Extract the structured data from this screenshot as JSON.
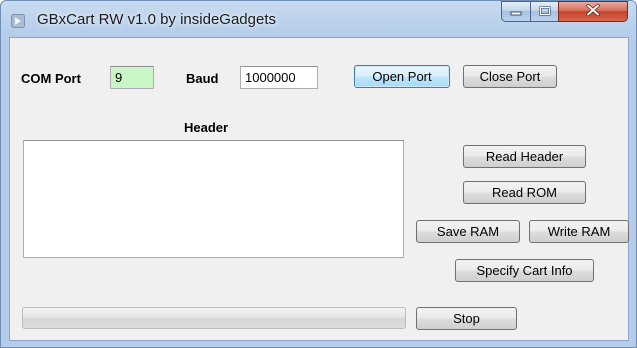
{
  "window": {
    "title": "GBxCart RW v1.0 by insideGadgets"
  },
  "caption_buttons": {
    "minimize_icon": "minimize-icon",
    "maximize_icon": "maximize-icon",
    "close_icon": "close-icon"
  },
  "connection": {
    "com_port_label": "COM Port",
    "com_port_value": "9",
    "com_port_bg": "#c8f7c5",
    "baud_label": "Baud",
    "baud_value": "1000000",
    "open_port_label": "Open Port",
    "close_port_label": "Close Port"
  },
  "header_section": {
    "label": "Header",
    "content": ""
  },
  "actions": {
    "read_header": "Read Header",
    "read_rom": "Read ROM",
    "save_ram": "Save RAM",
    "write_ram": "Write RAM",
    "specify_cart_info": "Specify Cart Info",
    "stop": "Stop"
  },
  "progress": {
    "value_percent": 0
  },
  "colors": {
    "titlebar_accent": "#bcd2ec",
    "focused_button": "#3c7fb1",
    "close_button": "#c2442a"
  }
}
